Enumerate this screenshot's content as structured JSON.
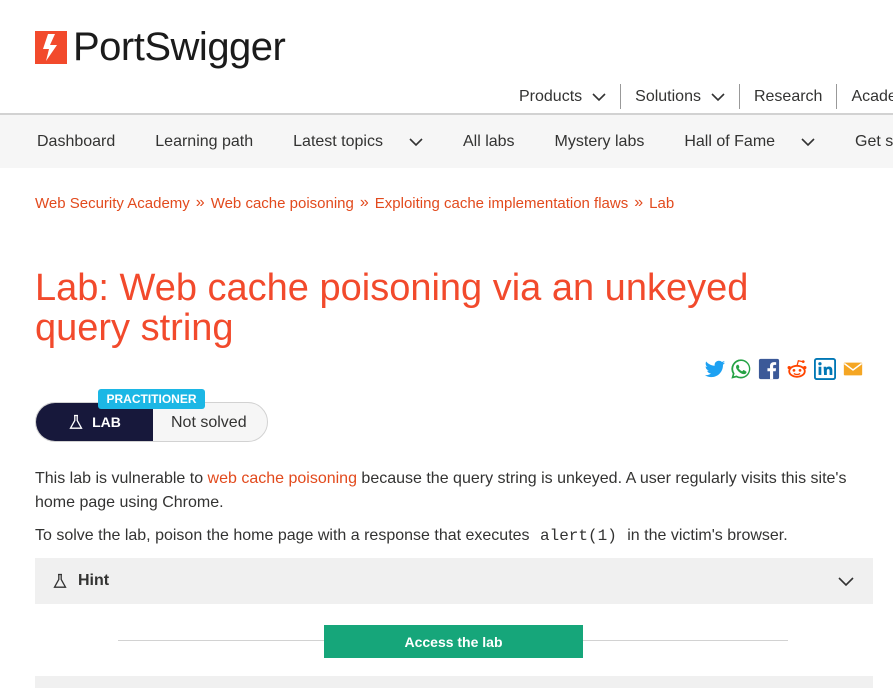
{
  "brand": {
    "name": "PortSwigger",
    "accent": "#f24a2c"
  },
  "top_nav": {
    "items": [
      {
        "label": "Products",
        "has_dropdown": true
      },
      {
        "label": "Solutions",
        "has_dropdown": true
      },
      {
        "label": "Research",
        "has_dropdown": false
      },
      {
        "label": "Acade",
        "has_dropdown": false
      }
    ]
  },
  "sub_nav": {
    "items": [
      {
        "label": "Dashboard",
        "has_dropdown": false
      },
      {
        "label": "Learning path",
        "has_dropdown": false
      },
      {
        "label": "Latest topics",
        "has_dropdown": true
      },
      {
        "label": "All labs",
        "has_dropdown": false
      },
      {
        "label": "Mystery labs",
        "has_dropdown": false
      },
      {
        "label": "Hall of Fame",
        "has_dropdown": true
      },
      {
        "label": "Get sta",
        "has_dropdown": false
      }
    ]
  },
  "breadcrumb": [
    "Web Security Academy",
    "Web cache poisoning",
    "Exploiting cache implementation flaws",
    "Lab"
  ],
  "page_title": "Lab: Web cache poisoning via an unkeyed query string",
  "share_icons": [
    "twitter-icon",
    "whatsapp-icon",
    "facebook-icon",
    "reddit-icon",
    "linkedin-icon",
    "email-icon"
  ],
  "lab_badge": {
    "level": "PRACTITIONER",
    "type": "LAB",
    "status": "Not solved"
  },
  "description": {
    "p1_before": "This lab is vulnerable to ",
    "p1_link": "web cache poisoning",
    "p1_after": " because the query string is unkeyed. A user regularly visits this site's home page using Chrome.",
    "p2_before": "To solve the lab, poison the home page with a response that executes ",
    "p2_code": "alert(1)",
    "p2_after": " in the victim's browser."
  },
  "hint": {
    "label": "Hint"
  },
  "access_button": "Access the lab",
  "colors": {
    "link": "#e24a1d",
    "lab_badge_bg": "#17183b",
    "level_badge_bg": "#1cb7e5",
    "access_button_bg": "#16a67a",
    "subnav_bg": "#f6f6f6"
  }
}
